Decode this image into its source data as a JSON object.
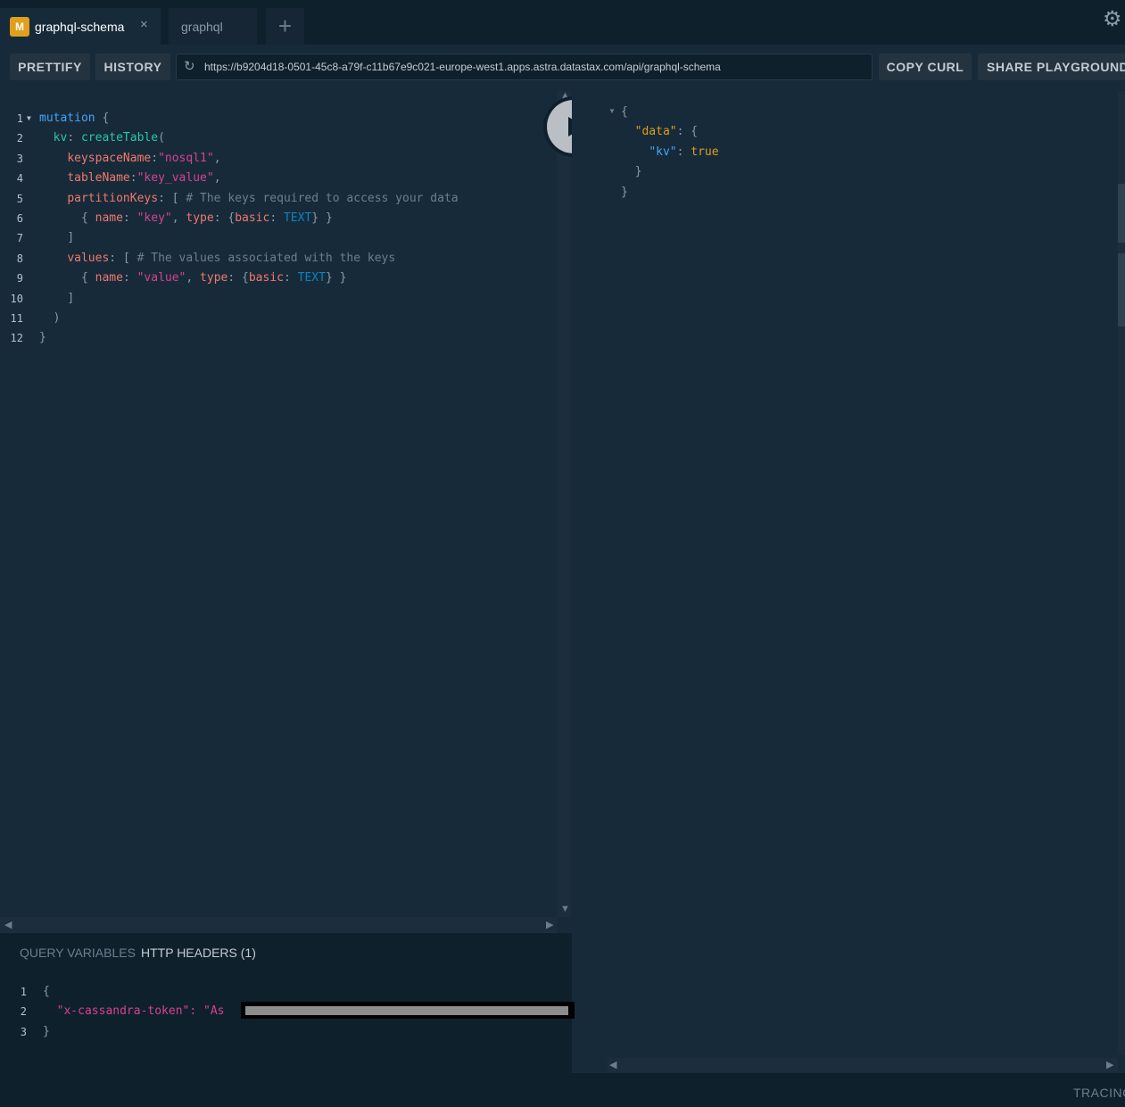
{
  "tabs": [
    {
      "badge": "M",
      "label": "graphql-schema",
      "close": "×"
    },
    {
      "label": "graphql"
    }
  ],
  "add_tab": "+",
  "settings_icon": "⚙",
  "toolbar": {
    "prettify": "PRETTIFY",
    "history": "HISTORY",
    "url": "https://b9204d18-0501-45c8-a79f-c11b67e9c021-europe-west1.apps.astra.datastax.com/api/graphql-schema",
    "copy_curl": "COPY CURL",
    "share": "SHARE PLAYGROUND"
  },
  "editor": {
    "line_numbers": [
      "1",
      "2",
      "3",
      "4",
      "5",
      "6",
      "7",
      "8",
      "9",
      "10",
      "11",
      "12"
    ],
    "lines": [
      "mutation {",
      "  kv: createTable(",
      "    keyspaceName:\"nosql1\",",
      "    tableName:\"key_value\",",
      "    partitionKeys: [ # The keys required to access your data",
      "      { name: \"key\", type: {basic: TEXT} }",
      "    ]",
      "    values: [ # The values associated with the keys",
      "      { name: \"value\", type: {basic: TEXT} }",
      "    ]",
      "  )",
      "}"
    ]
  },
  "result": {
    "lines": [
      "{",
      "  \"data\": {",
      "    \"kv\": true",
      "  }",
      "}"
    ]
  },
  "bottom": {
    "query_variables": "QUERY VARIABLES",
    "http_headers": "HTTP HEADERS (1)",
    "line_numbers": [
      "1",
      "2",
      "3"
    ],
    "header_lines": [
      "{",
      "  \"x-cassandra-token\": \"As",
      "}"
    ]
  },
  "footer": {
    "tracing": "TRACING"
  },
  "colors": {
    "background": "#172a3a",
    "badge": "#e09f1c",
    "keyword": "#42a5f5",
    "string": "#d64292"
  }
}
